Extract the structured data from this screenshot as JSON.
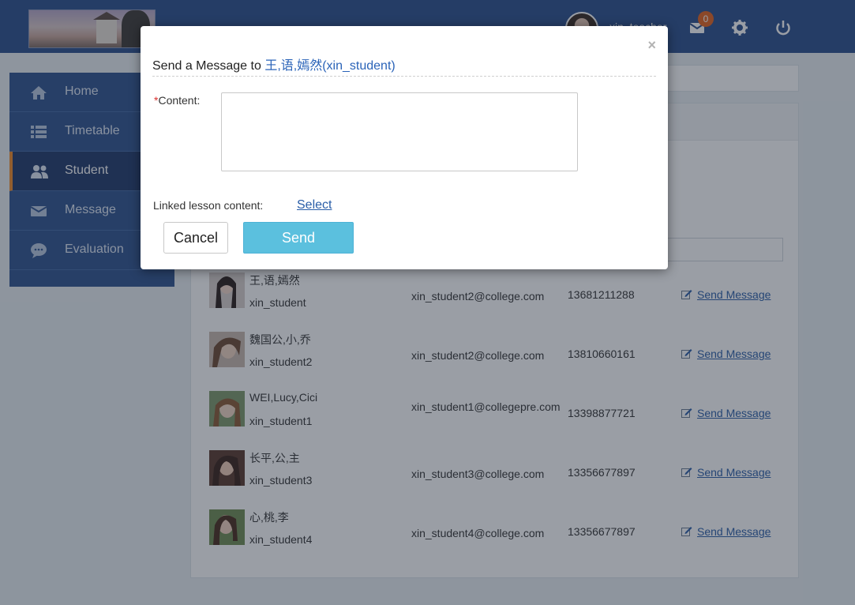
{
  "header": {
    "username": "xin_teacher",
    "message_count": "0",
    "icons": [
      "avatar",
      "mail-icon",
      "gear-icon",
      "power-icon"
    ]
  },
  "sidebar": {
    "items": [
      {
        "label": "Home",
        "icon": "home-icon"
      },
      {
        "label": "Timetable",
        "icon": "list-icon"
      },
      {
        "label": "Student",
        "icon": "users-icon",
        "active": true
      },
      {
        "label": "Message",
        "icon": "mail-icon"
      },
      {
        "label": "Evaluation",
        "icon": "chat-bubble-icon"
      }
    ],
    "active_accent": "#f08a29"
  },
  "students": [
    {
      "name": "王,语,嫣然",
      "username": "xin_student",
      "email": "xin_student2@college.com",
      "phone": "13681211288",
      "action": "Send Message"
    },
    {
      "name": "魏国公,小,乔",
      "username": "xin_student2",
      "email": "xin_student2@college.com",
      "phone": "13810660161",
      "action": "Send Message"
    },
    {
      "name": "WEI,Lucy,Cici",
      "username": "xin_student1",
      "email": "xin_student1@collegepre.com",
      "phone": "13398877721",
      "action": "Send Message"
    },
    {
      "name": "长平,公,主",
      "username": "xin_student3",
      "email": "xin_student3@college.com",
      "phone": "13356677897",
      "action": "Send Message"
    },
    {
      "name": "心,桃,李",
      "username": "xin_student4",
      "email": "xin_student4@college.com",
      "phone": "13356677897",
      "action": "Send Message"
    }
  ],
  "modal": {
    "title_prefix": "Send a Message to",
    "recipient": "王,语,嫣然(xin_student)",
    "close_symbol": "×",
    "required_mark": "*",
    "content_label": "Content:",
    "content_value": "",
    "linked_label": "Linked lesson content:",
    "select_link": "Select",
    "cancel_label": "Cancel",
    "send_label": "Send"
  },
  "colors": {
    "header_bg": "#2b4f8c",
    "sidebar_bg": "#2e528f",
    "send_button": "#5bc0de",
    "link": "#2a5ea8",
    "badge": "#e3631e"
  }
}
